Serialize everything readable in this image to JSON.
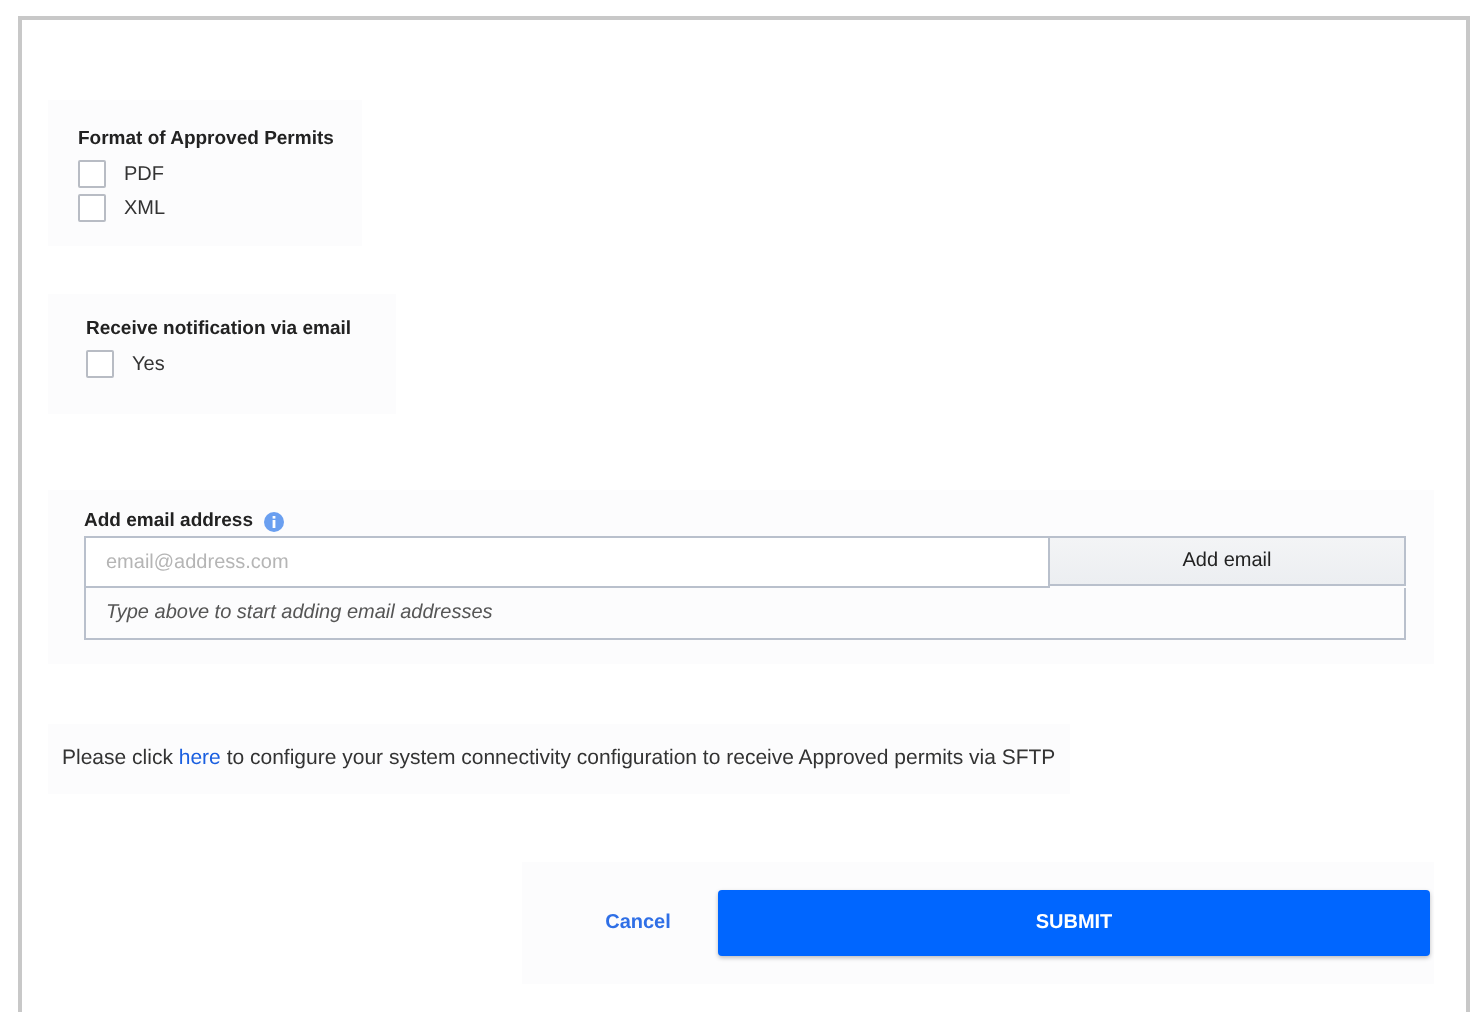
{
  "format_section": {
    "title": "Format of Approved Permits",
    "options": [
      {
        "label": "PDF",
        "checked": false
      },
      {
        "label": "XML",
        "checked": false
      }
    ]
  },
  "notification_section": {
    "title": "Receive notification via email",
    "options": [
      {
        "label": "Yes",
        "checked": false
      }
    ]
  },
  "email_section": {
    "label": "Add email address",
    "input": {
      "placeholder": "email@address.com"
    },
    "add_button": "Add email",
    "hint": "Type above to start adding email addresses"
  },
  "connectivity_note": {
    "before": "Please click",
    "link": "here",
    "after": "to configure your system connectivity configuration to receive Approved permits via SFTP"
  },
  "actions": {
    "cancel": "Cancel",
    "submit": "SUBMIT"
  }
}
